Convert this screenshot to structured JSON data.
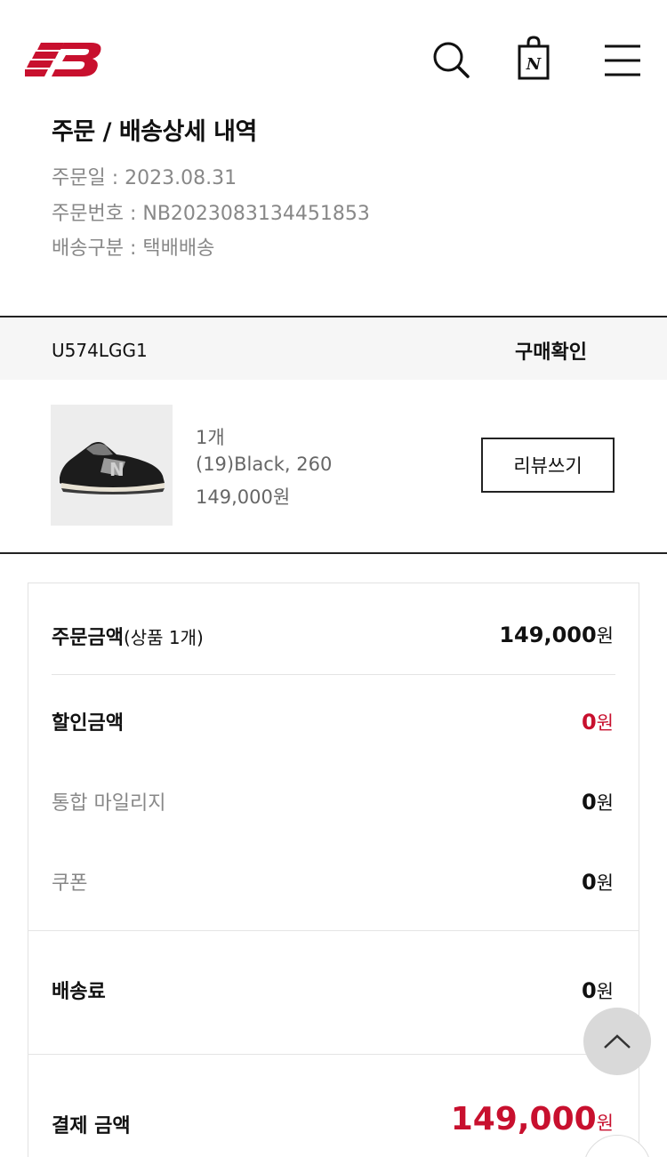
{
  "order": {
    "title": "주문 / 배송상세 내역",
    "date": "주문일 : 2023.08.31",
    "number": "주문번호 : NB2023083134451853",
    "shipping_type": "배송구분 : 택배배송"
  },
  "product": {
    "code": "U574LGG1",
    "status": "구매확인",
    "quantity": "1개",
    "option": "(19)Black, 260",
    "price": "149,000원",
    "review_label": "리뷰쓰기"
  },
  "summary": {
    "order_amount_label": "주문금액",
    "order_amount_sub": "(상품 1개)",
    "order_amount_value": "149,000",
    "discount_label": "할인금액",
    "discount_value": "0",
    "mileage_label": "통합 마일리지",
    "mileage_value": "0",
    "coupon_label": "쿠폰",
    "coupon_value": "0",
    "shipping_label": "배송료",
    "shipping_value": "0",
    "payment_label": "결제 금액",
    "payment_value": "149,000",
    "unit": "원"
  },
  "colors": {
    "brand_red": "#c8102e",
    "text": "#111111",
    "muted": "#888888"
  },
  "icons": [
    "new-balance-logo",
    "search-icon",
    "shopping-bag-icon",
    "hamburger-menu-icon",
    "chevron-up-icon"
  ]
}
